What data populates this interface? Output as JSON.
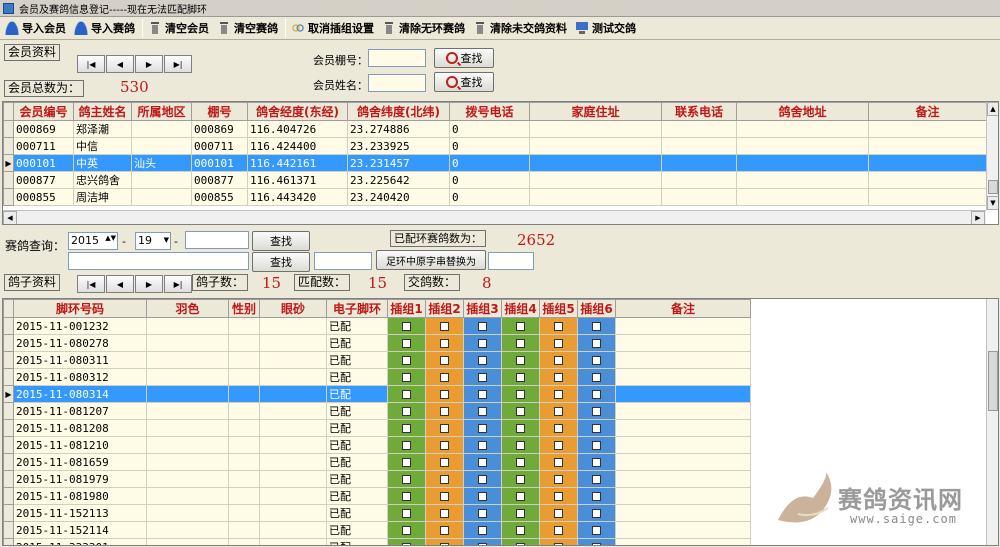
{
  "window": {
    "title": "会员及赛鸽信息登记-----现在无法匹配脚环"
  },
  "toolbar": [
    {
      "label": "导入会员",
      "icon": "person-icon"
    },
    {
      "label": "导入赛鸽",
      "icon": "person-icon"
    },
    {
      "label": "清空会员",
      "icon": "trash-icon"
    },
    {
      "label": "清空赛鸽",
      "icon": "trash-icon"
    },
    {
      "label": "取消插组设置",
      "icon": "link-icon"
    },
    {
      "label": "清除无环赛鸽",
      "icon": "trash-icon"
    },
    {
      "label": "清除未交鸽资料",
      "icon": "trash-icon"
    },
    {
      "label": "测试交鸽",
      "icon": "computer-icon"
    }
  ],
  "member_section": {
    "group_label": "会员资料",
    "count_label": "会员总数为：",
    "count_value": "530",
    "nav": [
      "|◀",
      "◀",
      "▶",
      "▶|"
    ],
    "loft_label": "会员棚号：",
    "loft_value": "",
    "name_label": "会员姓名：",
    "name_value": "",
    "search_label": "查找"
  },
  "member_grid": {
    "columns": [
      "会员编号",
      "鸽主姓名",
      "所属地区",
      "棚号",
      "鸽舍经度(东经)",
      "鸽舍纬度(北纬)",
      "拨号电话",
      "家庭住址",
      "联系电话",
      "鸽舍地址",
      "备注"
    ],
    "rows": [
      [
        "000869",
        "郑泽潮",
        "",
        "000869",
        "116.404726",
        "23.274886",
        "0",
        "",
        "",
        "",
        ""
      ],
      [
        "000711",
        "中信",
        "",
        "000711",
        "116.424400",
        "23.233925",
        "0",
        "",
        "",
        "",
        ""
      ],
      [
        "000101",
        "中英",
        "汕头",
        "000101",
        "116.442161",
        "23.231457",
        "0",
        "",
        "",
        "",
        ""
      ],
      [
        "000877",
        "忠兴鸽舍",
        "",
        "000877",
        "116.461371",
        "23.225642",
        "0",
        "",
        "",
        "",
        ""
      ],
      [
        "000855",
        "周洁坤",
        "",
        "000855",
        "116.443420",
        "23.240420",
        "0",
        "",
        "",
        "",
        ""
      ]
    ],
    "selected_index": 2
  },
  "race_section": {
    "query_label": "赛鸽查询：",
    "year": "2015",
    "code": "19",
    "dash": "-",
    "ring_input": "",
    "search_label": "查找",
    "second_input": "",
    "search2_label": "查找",
    "replace_input": "",
    "replace_label": "足环中原字串替换为",
    "replace_value": "",
    "matched_label": "已配环赛鸽数为：",
    "matched_value": "2652",
    "pigeon_group_label": "鸽子资料",
    "nav": [
      "|◀",
      "◀",
      "▶",
      "▶|"
    ],
    "pigeon_count_label": "鸽子数：",
    "pigeon_count_value": "15",
    "match_count_label": "匹配数：",
    "match_count_value": "15",
    "handed_count_label": "交鸽数：",
    "handed_count_value": "8"
  },
  "pigeon_grid": {
    "columns": [
      "脚环号码",
      "羽色",
      "性别",
      "眼砂",
      "电子脚环",
      "插组1",
      "插组2",
      "插组3",
      "插组4",
      "插组5",
      "插组6",
      "备注"
    ],
    "rows": [
      [
        "2015-11-001232",
        "",
        "",
        "",
        "已配"
      ],
      [
        "2015-11-080278",
        "",
        "",
        "",
        "已配"
      ],
      [
        "2015-11-080311",
        "",
        "",
        "",
        "已配"
      ],
      [
        "2015-11-080312",
        "",
        "",
        "",
        "已配"
      ],
      [
        "2015-11-080314",
        "",
        "",
        "",
        "已配"
      ],
      [
        "2015-11-081207",
        "",
        "",
        "",
        "已配"
      ],
      [
        "2015-11-081208",
        "",
        "",
        "",
        "已配"
      ],
      [
        "2015-11-081210",
        "",
        "",
        "",
        "已配"
      ],
      [
        "2015-11-081659",
        "",
        "",
        "",
        "已配"
      ],
      [
        "2015-11-081979",
        "",
        "",
        "",
        "已配"
      ],
      [
        "2015-11-081980",
        "",
        "",
        "",
        "已配"
      ],
      [
        "2015-11-152113",
        "",
        "",
        "",
        "已配"
      ],
      [
        "2015-11-152114",
        "",
        "",
        "",
        "已配"
      ],
      [
        "2015-11-333301",
        "",
        "",
        "",
        "已配"
      ]
    ],
    "selected_index": 4,
    "group_colors": [
      "#6faa3a",
      "#e89c32",
      "#4a8ed8",
      "#6faa3a",
      "#e89c32",
      "#4a8ed8"
    ]
  },
  "watermark": {
    "text": "赛鸽资讯网",
    "url": "www.saige.com"
  }
}
